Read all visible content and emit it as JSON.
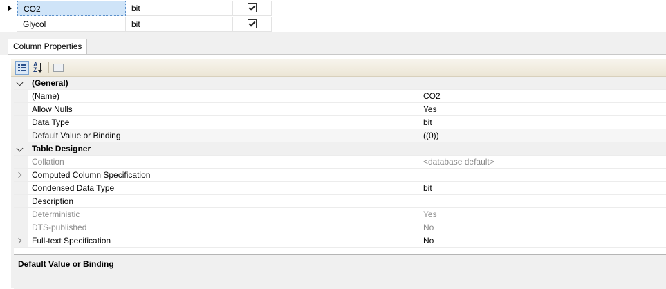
{
  "grid": {
    "rows": [
      {
        "name": "CO2",
        "type": "bit",
        "allow_nulls": true,
        "selected": true
      },
      {
        "name": "Glycol",
        "type": "bit",
        "allow_nulls": true,
        "selected": false
      }
    ]
  },
  "tabs": [
    {
      "label": "Column Properties",
      "active": true
    }
  ],
  "toolbar": {
    "buttons": [
      {
        "icon": "categorized-icon",
        "active": true
      },
      {
        "icon": "alphabetical-sort-icon",
        "active": false
      },
      {
        "icon": "property-pages-icon",
        "active": false
      }
    ]
  },
  "properties": {
    "general_label": "(General)",
    "name_label": "(Name)",
    "name_value": "CO2",
    "allow_nulls_label": "Allow Nulls",
    "allow_nulls_value": "Yes",
    "data_type_label": "Data Type",
    "data_type_value": "bit",
    "default_label": "Default Value or Binding",
    "default_value": "((0))",
    "table_designer_label": "Table Designer",
    "collation_label": "Collation",
    "collation_value": "<database default>",
    "computed_label": "Computed Column Specification",
    "condensed_label": "Condensed Data Type",
    "condensed_value": "bit",
    "description_label": "Description",
    "deterministic_label": "Deterministic",
    "deterministic_value": "Yes",
    "dts_label": "DTS-published",
    "dts_value": "No",
    "fulltext_label": "Full-text Specification",
    "fulltext_value": "No"
  },
  "description_panel": {
    "title": "Default Value or Binding"
  }
}
